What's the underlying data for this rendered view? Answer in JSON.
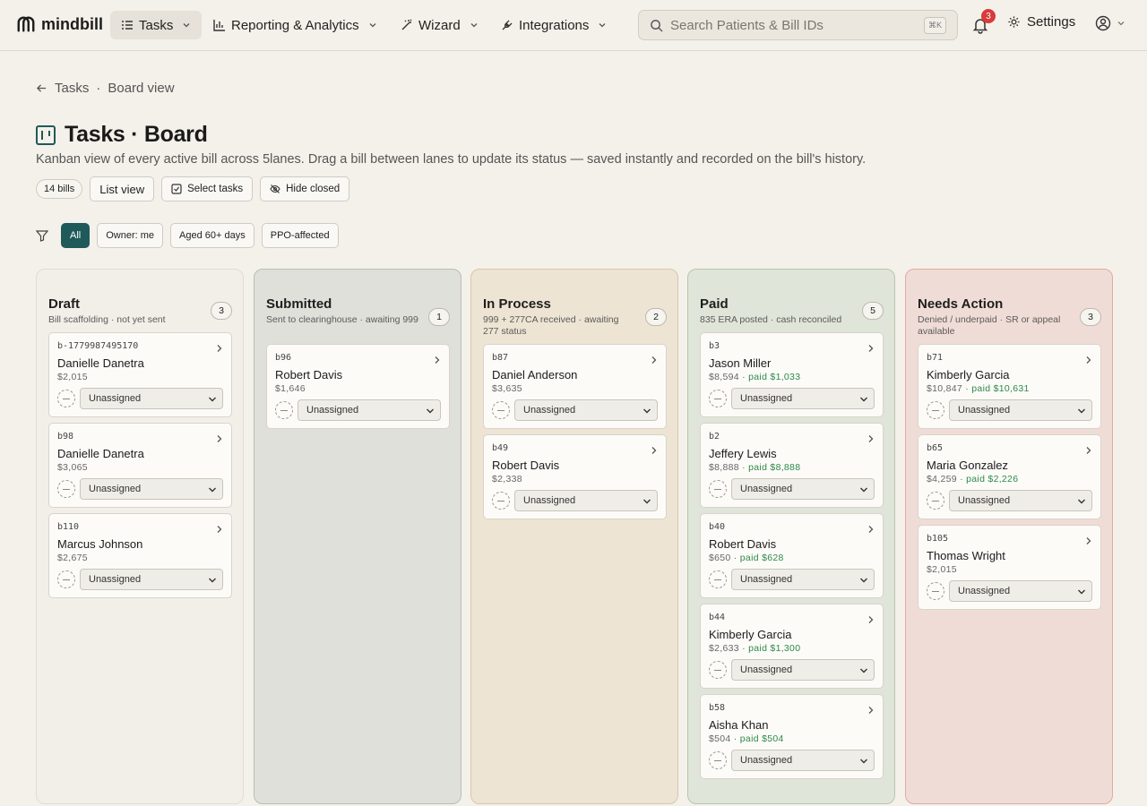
{
  "app": {
    "brand": "mindbill"
  },
  "nav": {
    "tasks": "Tasks",
    "reporting": "Reporting & Analytics",
    "wizard": "Wizard",
    "integrations": "Integrations",
    "search_placeholder": "Search Patients & Bill IDs",
    "search_shortcut": "⌘K",
    "notifications_count": "3",
    "settings": "Settings"
  },
  "breadcrumb": {
    "back": "Tasks",
    "separator": "·",
    "current": "Board view"
  },
  "header": {
    "title": "Tasks · Board",
    "subtitle": "Kanban view of every active bill across 5lanes. Drag a bill between lanes to update its status — saved instantly and recorded on the bill's history."
  },
  "toolbar": {
    "bill_count": "14 bills",
    "list_view": "List view",
    "select_tasks": "Select tasks",
    "hide_closed": "Hide closed"
  },
  "filters": [
    "All",
    "Owner: me",
    "Aged 60+ days",
    "PPO-affected"
  ],
  "colors": {
    "accent": "#1f5a5a",
    "paid_text": "#2e8a4a",
    "lane_draft": "#f2efe8",
    "lane_submitted": "#dfe0da",
    "lane_in_process": "#ede4d3",
    "lane_paid": "#dfe5d8",
    "lane_needs_action": "#f0dcd6"
  },
  "lanes": [
    {
      "title": "Draft",
      "desc": "Bill scaffolding · not yet sent",
      "count": "3",
      "cards": [
        {
          "id": "b-1779987495170",
          "name": "Danielle Danetra",
          "amount": "$2,015",
          "paid": "",
          "assignee": "Unassigned"
        },
        {
          "id": "b98",
          "name": "Danielle Danetra",
          "amount": "$3,065",
          "paid": "",
          "assignee": "Unassigned"
        },
        {
          "id": "b110",
          "name": "Marcus Johnson",
          "amount": "$2,675",
          "paid": "",
          "assignee": "Unassigned"
        }
      ]
    },
    {
      "title": "Submitted",
      "desc": "Sent to clearinghouse · awaiting 999",
      "count": "1",
      "cards": [
        {
          "id": "b96",
          "name": "Robert Davis",
          "amount": "$1,646",
          "paid": "",
          "assignee": "Unassigned"
        }
      ]
    },
    {
      "title": "In Process",
      "desc": "999 + 277CA received · awaiting 277 status",
      "count": "2",
      "cards": [
        {
          "id": "b87",
          "name": "Daniel Anderson",
          "amount": "$3,635",
          "paid": "",
          "assignee": "Unassigned"
        },
        {
          "id": "b49",
          "name": "Robert Davis",
          "amount": "$2,338",
          "paid": "",
          "assignee": "Unassigned"
        }
      ]
    },
    {
      "title": "Paid",
      "desc": "835 ERA posted · cash reconciled",
      "count": "5",
      "cards": [
        {
          "id": "b3",
          "name": "Jason Miller",
          "amount": "$8,594",
          "paid": "paid $1,033",
          "assignee": "Unassigned"
        },
        {
          "id": "b2",
          "name": "Jeffery Lewis",
          "amount": "$8,888",
          "paid": "paid $8,888",
          "assignee": "Unassigned"
        },
        {
          "id": "b40",
          "name": "Robert Davis",
          "amount": "$650",
          "paid": "paid $628",
          "assignee": "Unassigned"
        },
        {
          "id": "b44",
          "name": "Kimberly Garcia",
          "amount": "$2,633",
          "paid": "paid $1,300",
          "assignee": "Unassigned"
        },
        {
          "id": "b58",
          "name": "Aisha Khan",
          "amount": "$504",
          "paid": "paid $504",
          "assignee": "Unassigned"
        }
      ]
    },
    {
      "title": "Needs Action",
      "desc": "Denied / underpaid · SR or appeal available",
      "count": "3",
      "cards": [
        {
          "id": "b71",
          "name": "Kimberly Garcia",
          "amount": "$10,847",
          "paid": "paid $10,631",
          "assignee": "Unassigned"
        },
        {
          "id": "b65",
          "name": "Maria Gonzalez",
          "amount": "$4,259",
          "paid": "paid $2,226",
          "assignee": "Unassigned"
        },
        {
          "id": "b105",
          "name": "Thomas Wright",
          "amount": "$2,015",
          "paid": "",
          "assignee": "Unassigned"
        }
      ]
    }
  ]
}
